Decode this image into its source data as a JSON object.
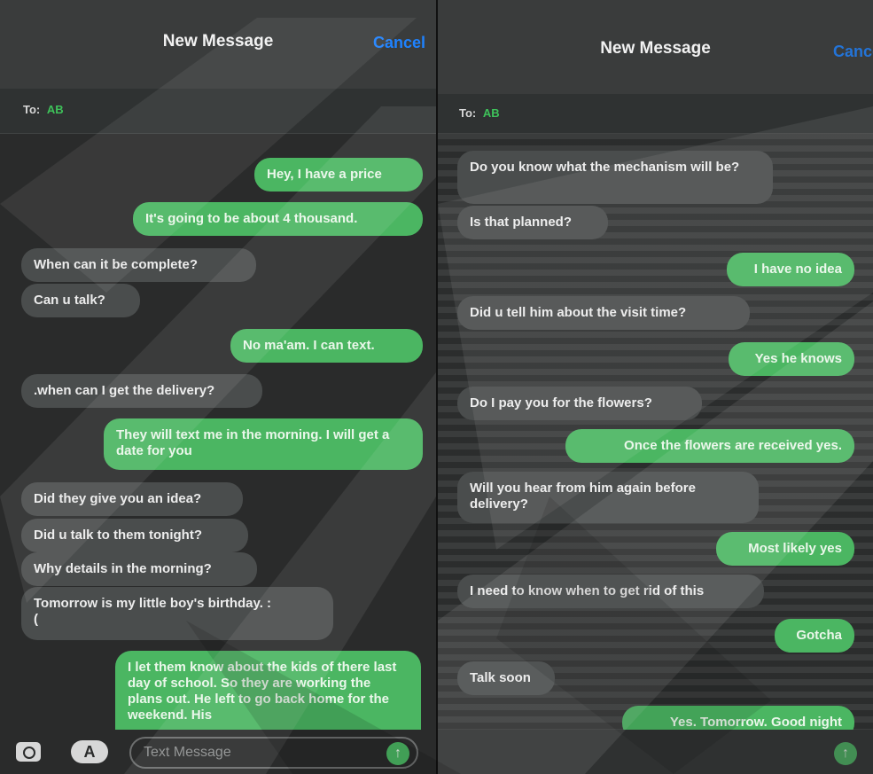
{
  "left": {
    "title": "New Message",
    "cancel": "Cancel",
    "to_label": "To:",
    "recipient": "AB",
    "messages": [
      {
        "dir": "out",
        "text": "Hey, I have a price"
      },
      {
        "dir": "out",
        "text": "It's going to be about 4 thousand."
      },
      {
        "dir": "in",
        "text": "When can it be complete?"
      },
      {
        "dir": "in",
        "text": "Can u talk?"
      },
      {
        "dir": "out",
        "text": "No ma'am. I can text."
      },
      {
        "dir": "in",
        "text": ".when can I get the delivery?"
      },
      {
        "dir": "out",
        "text": "They will text me in the morning. I will get a date for you"
      },
      {
        "dir": "in",
        "text": "Did they give you an idea?"
      },
      {
        "dir": "in",
        "text": "Did u talk to them tonight?"
      },
      {
        "dir": "in",
        "text": "Why details in the morning?"
      },
      {
        "dir": "in",
        "text": "Tomorrow is my little boy's birthday. :\n("
      },
      {
        "dir": "out",
        "text": "I let them know about the kids of there last day of school. So they are working the plans out. He left to go back home for the weekend. His"
      }
    ],
    "composer_placeholder": "Text Message",
    "send_glyph": "↑",
    "appstore_glyph": "A"
  },
  "right": {
    "title": "New Message",
    "cancel": "Cancel",
    "to_label": "To:",
    "recipient": "AB",
    "messages": [
      {
        "dir": "in",
        "text": "Do you know what the mechanism will be?"
      },
      {
        "dir": "in",
        "text": "Is that planned?"
      },
      {
        "dir": "out",
        "text": "I have no idea"
      },
      {
        "dir": "in",
        "text": "Did u tell him about the visit time?"
      },
      {
        "dir": "out",
        "text": "Yes he knows"
      },
      {
        "dir": "in",
        "text": "Do I pay you for the flowers?"
      },
      {
        "dir": "out",
        "text": "Once the flowers are received yes."
      },
      {
        "dir": "in",
        "text": "Will you hear from him again before delivery?"
      },
      {
        "dir": "out",
        "text": "Most likely yes"
      },
      {
        "dir": "in",
        "text": "I need to know when to get rid of this"
      },
      {
        "dir": "out",
        "text": "Gotcha"
      },
      {
        "dir": "in",
        "text": "Talk soon"
      },
      {
        "dir": "out",
        "text": "Yes. Tomorrow. Good night"
      }
    ],
    "send_glyph": "↑"
  },
  "colors": {
    "outgoing": "#4bb662",
    "incoming": "#4a4d4d",
    "link": "#1e82ff",
    "background": "#2a2b2b"
  },
  "icons": [
    "camera-icon",
    "app-store-icon",
    "send-arrow-icon"
  ]
}
